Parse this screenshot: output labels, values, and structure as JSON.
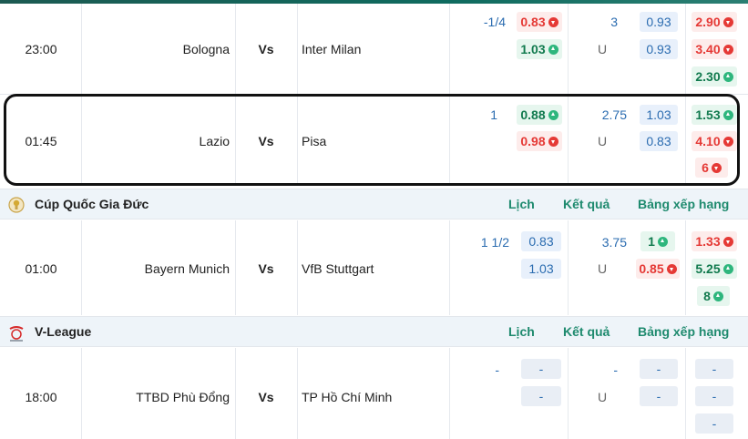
{
  "vs_label": "Vs",
  "under_label": "U",
  "leagues": [
    {
      "name": "Cúp Quốc Gia Đức",
      "links": [
        "Lịch",
        "Kết quả",
        "Bảng xếp hạng"
      ]
    },
    {
      "name": "V-League",
      "links": [
        "Lịch",
        "Kết quả",
        "Bảng xếp hạng"
      ]
    }
  ],
  "matches": [
    {
      "time": "23:00",
      "home": "Bologna",
      "away": "Inter Milan",
      "handicap": "-1/4",
      "hcp_home": "0.83",
      "hcp_away": "1.03",
      "ou_line": "3",
      "over": "0.93",
      "under": "0.93",
      "x1": "2.90",
      "x2": "3.40",
      "x3": "2.30"
    },
    {
      "time": "01:45",
      "home": "Lazio",
      "away": "Pisa",
      "handicap": "1",
      "hcp_home": "0.88",
      "hcp_away": "0.98",
      "ou_line": "2.75",
      "over": "1.03",
      "under": "0.83",
      "x1": "1.53",
      "x2": "4.10",
      "x3": "6"
    },
    {
      "time": "01:00",
      "home": "Bayern Munich",
      "away": "VfB Stuttgart",
      "handicap": "1 1/2",
      "hcp_home": "0.83",
      "hcp_away": "1.03",
      "ou_line": "3.75",
      "over": "1",
      "under": "0.85",
      "x1": "1.33",
      "x2": "5.25",
      "x3": "8"
    },
    {
      "time": "18:00",
      "home": "TTBD Phù Đổng",
      "away": "TP Hồ Chí Minh",
      "handicap": "-",
      "hcp_home": "-",
      "hcp_away": "-",
      "ou_line": "-",
      "over": "-",
      "under": "-",
      "x1": "-",
      "x2": "-",
      "x3": "-"
    }
  ],
  "colors": {
    "accent": "#1e8a6e",
    "odds_down": "#e53935",
    "odds_up": "#2eb67d",
    "link": "#2b6cb0",
    "league_bg": "#eef4f9"
  }
}
